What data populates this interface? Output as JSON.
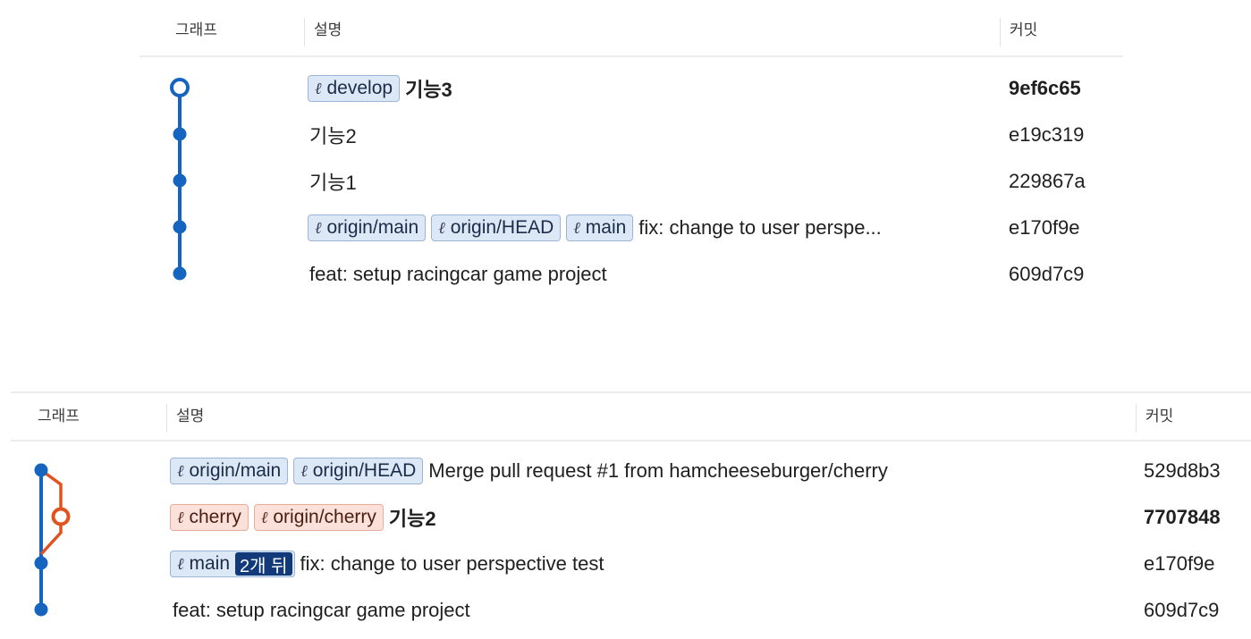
{
  "top_panel": {
    "headers": {
      "graph": "그래프",
      "description": "설명",
      "commit": "커밋"
    },
    "rows": [
      {
        "badges": [
          "develop"
        ],
        "message": "기능3",
        "commit": "9ef6c65",
        "bold": true
      },
      {
        "badges": [],
        "message": "기능2",
        "commit": "e19c319",
        "bold": false
      },
      {
        "badges": [],
        "message": "기능1",
        "commit": "229867a",
        "bold": false
      },
      {
        "badges": [
          "origin/main",
          "origin/HEAD",
          "main"
        ],
        "message": "fix: change to user perspe...",
        "commit": "e170f9e",
        "bold": false
      },
      {
        "badges": [],
        "message": "feat: setup racingcar game project",
        "commit": "609d7c9",
        "bold": false
      }
    ]
  },
  "bottom_panel": {
    "headers": {
      "graph": "그래프",
      "description": "설명",
      "commit": "커밋"
    },
    "rows": [
      {
        "badges": [
          "origin/main",
          "origin/HEAD"
        ],
        "message": "Merge pull request #1 from hamcheeseburger/cherry",
        "commit": "529d8b3",
        "bold": false
      },
      {
        "badges": [
          "cherry",
          "origin/cherry"
        ],
        "message": "기능2",
        "commit": "7707848",
        "bold": true
      },
      {
        "badges": [
          "main"
        ],
        "behind": "2개 뒤",
        "message": "fix: change to user perspective test",
        "commit": "e170f9e",
        "bold": false
      },
      {
        "badges": [],
        "message": "feat: setup racingcar game project",
        "commit": "609d7c9",
        "bold": false
      }
    ]
  },
  "icons": {
    "branch": "branch-icon",
    "glyph": "ℓ"
  },
  "colors": {
    "blue_graph": "#1565c0",
    "orange_graph": "#e0531f",
    "badge_blue": "#dde8f7",
    "badge_red": "#fbe1da",
    "behind_pill": "#123a7a"
  }
}
